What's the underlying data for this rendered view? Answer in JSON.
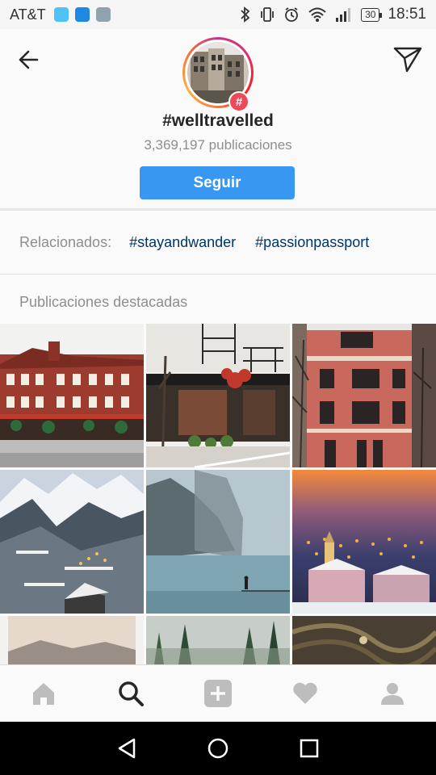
{
  "status_bar": {
    "carrier": "AT&T",
    "battery": "30",
    "time": "18:51"
  },
  "header": {
    "hashtag": "#welltravelled",
    "post_count": "3,369,197 publicaciones",
    "follow_label": "Seguir",
    "badge_symbol": "#"
  },
  "related": {
    "label": "Relacionados:",
    "tags": [
      "#stayandwander",
      "#passionpassport"
    ]
  },
  "featured": {
    "title": "Publicaciones destacadas"
  },
  "tabs": [
    "home-icon",
    "search-icon",
    "add-post-icon",
    "activity-heart-icon",
    "profile-icon"
  ],
  "colors": {
    "accent": "#3897f0",
    "link": "#003569",
    "secondary_text": "#8e8e8e"
  }
}
